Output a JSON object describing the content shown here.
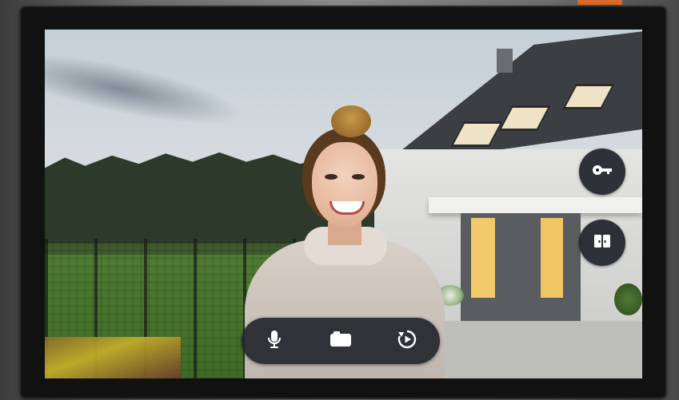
{
  "screen": {
    "controls": {
      "side": [
        {
          "name": "unlock",
          "icon": "key-icon"
        },
        {
          "name": "gate",
          "icon": "double-door-icon"
        }
      ],
      "bottom": [
        {
          "name": "talk",
          "icon": "microphone-icon"
        },
        {
          "name": "record",
          "icon": "camera-icon"
        },
        {
          "name": "replay",
          "icon": "playback-icon"
        }
      ]
    }
  },
  "colors": {
    "control_bg": "#1e2228",
    "icon": "#ffffff",
    "device_frame": "#111111",
    "wall_accent": "#d96a2a"
  }
}
